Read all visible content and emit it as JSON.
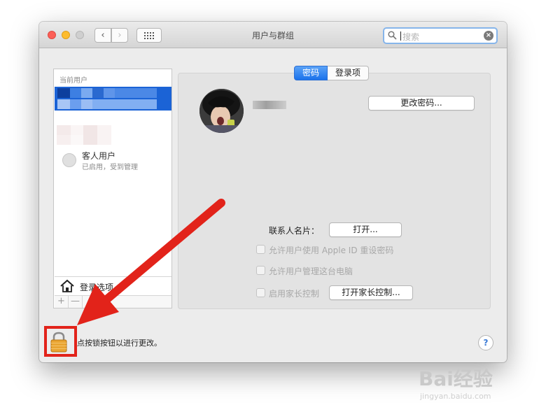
{
  "window": {
    "title": "用户与群组"
  },
  "search": {
    "placeholder": "搜索"
  },
  "sidebar": {
    "header": "当前用户",
    "guest": {
      "name": "客人用户",
      "status": "已启用，受到管理"
    },
    "login_options": "登录选项",
    "add": "+",
    "remove": "—"
  },
  "tabs": [
    {
      "label": "密码",
      "active": true
    },
    {
      "label": "登录项",
      "active": false
    }
  ],
  "main": {
    "change_password": "更改密码...",
    "contact_card_label": "联系人名片：",
    "open_button": "打开...",
    "allow_appleid": "允许用户使用 Apple ID 重设密码",
    "allow_admin": "允许用户管理这台电脑",
    "parental_controls": "启用家长控制",
    "open_parental": "打开家长控制..."
  },
  "footer": {
    "lock_text": "点按锁按钮以进行更改。",
    "help": "?"
  },
  "watermark": {
    "brand": "Bai经验",
    "url": "jingyan.baidu.com"
  },
  "colors": {
    "accent": "#1b63d6",
    "annotation": "#e2231a"
  }
}
